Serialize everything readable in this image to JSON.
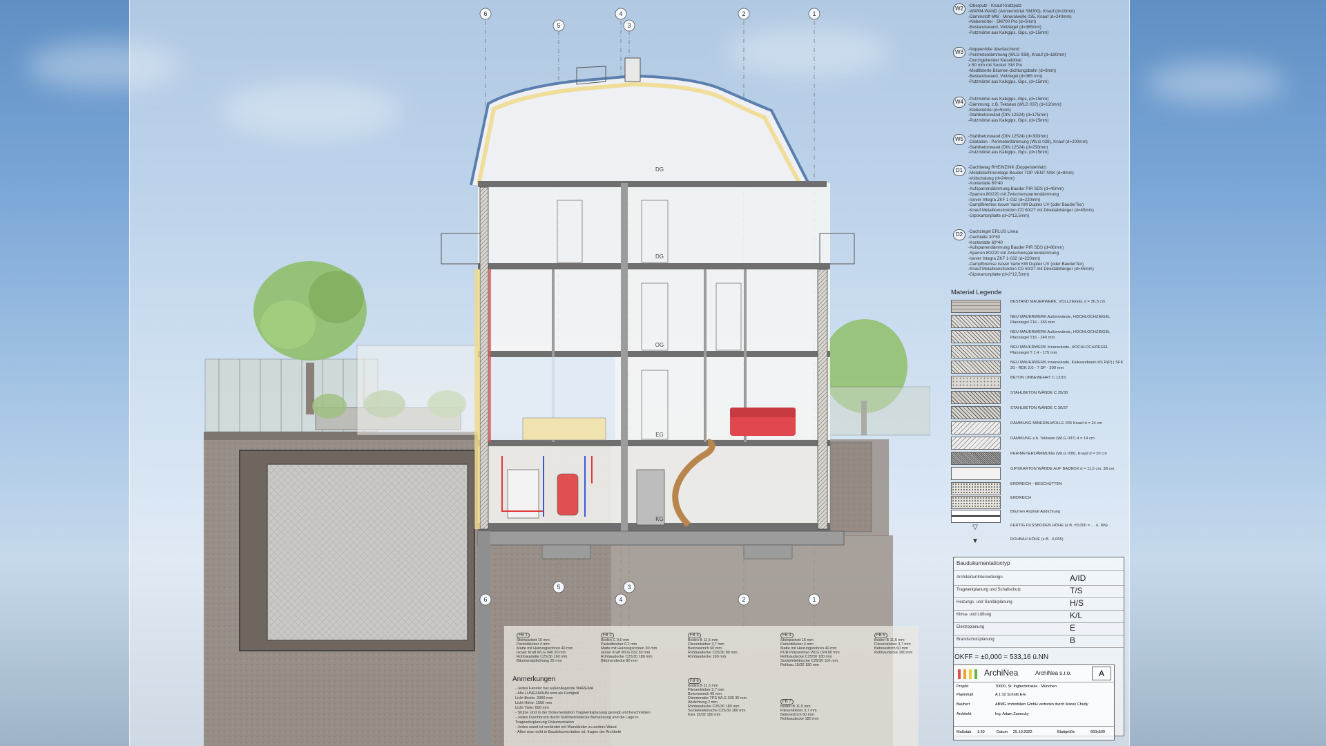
{
  "colors": {
    "sky_top": "#5f8fc4",
    "sheet": "#f4f7fc",
    "ground": "#8c7f75",
    "tree_green": "#8fbf6a",
    "sofa_red": "#e0474f",
    "insulation_yellow": "#f0d98a",
    "roof_blue": "#5a7fae"
  },
  "axes": {
    "top": [
      "6",
      "5",
      "4",
      "3",
      "2",
      "1"
    ],
    "bottom": [
      "6",
      "5",
      "4",
      "3",
      "2",
      "1"
    ]
  },
  "room_labels": {
    "attic": "DG",
    "floor3": "DG",
    "floor2": "OG",
    "floor1": "EG",
    "basement": "KG"
  },
  "wall_types": [
    {
      "code": "W2",
      "lines": [
        "-Oberputz - Knauf Kratzputz",
        "-WARM-WAND (Armiermörtel SM300), Knauf (d=10mm)",
        "-Dämmstoff MW - Mineralwolle 035, Knauf (d=240mm)",
        "-Klebemörtel - SM700 Pro (d=5mm)",
        "-Bestandswand, Vollziegel (d=365mm)",
        "-Putzmörtel aus Kalkgips, Gips, (d=15mm)"
      ]
    },
    {
      "code": "W3",
      "lines": [
        "-Noppenfolie überlaschend",
        "-Perimeterdämmung (WLG 038), Knauf (d=160mm)",
        "-Durchgehender Kieselübtal",
        "  ≥ 50 mm mit Sockel: SM Pro",
        "-Modifizierte Bitumen-dichtungsbahn (d=8mm)",
        "-Bestandswand, Vollziegel (d=365 mm)",
        "-Putzmörtel aus Kalkgips, Gips, (d=15mm)"
      ]
    },
    {
      "code": "W4",
      "lines": [
        "-Putzmörtel aus Kalkgips, Gips, (d=15mm)",
        "-Dämmung, z.B. Tektalan (WLG 037) (d=120mm)",
        "-Klebemörtel (d=5mm)",
        "-Stahlbetonwänd (DIN 12524) (d=175mm)",
        "-Putzmörtel aus Kalkgips, Gips, (d=15mm)"
      ]
    },
    {
      "code": "W5",
      "lines": [
        "-Stahlbetonwand (DIN 12524) (d=300mm)",
        "-Dilatation - Perimeterdämmung (WLG 038), Knauf (d=200mm)",
        "-Stahlbetonwand (DIN 12524) (d=250mm)",
        "-Putzmörtel aus Kalkgips, Gips, (d=15mm)"
      ]
    },
    {
      "code": "D1",
      "lines": [
        "-Dachbelag RHEINZINK (Doppelstehfalz)",
        "-Metalldachtrennlage Bauder TOP VENT NSK (d=8mm)",
        "-Vollschalung (d=24mm)",
        "-Konterlatte 60*40",
        "-Aufsparrendämmung Bauder PIR SDS (d=40mm)",
        "-Sparren 80/220 mit Zwischensparrendämmung",
        "-Isover Integra ZKF 1-032 (d=220mm)",
        "-Dampfbremse Isover Vario KM Duplex UV (oder BauderTex)",
        "-Knauf Metallkonstruktion CD 60/27 mit Direktabhänger (d=45mm)",
        "-Gipskartonplatte (d=2*12,5mm)"
      ]
    },
    {
      "code": "D2",
      "lines": [
        "-Dachziegel ERLUS Linea",
        "-Dachlatte 30*50",
        "-Konterlatte 60*40",
        "-Aufsparrendämmung Bauder PIR SDS (d=80mm)",
        "-Sparren 80/220 mit Zwischensparrendämmung",
        "-Isover Integra ZKF 1-032 (d=220mm)",
        "-Dampfbremse Isover Vario KM Duplex UV (oder BauderTex)",
        "-Knauf Metallkonstruktion CD 60/27 mit Direktabhänger (d=45mm)",
        "-Gipskartonplatte (d=2*12,5mm)"
      ]
    }
  ],
  "material_legend": {
    "title": "Material Legende",
    "items": [
      {
        "label": "BESTAND MAUERWERK, VOLLZIEGEL d = 36,5 cm",
        "pattern": "brick"
      },
      {
        "label": "NEU MAUERWERK Außenwände, HOCHLOCHZIEGEL Planziegel T16 - 365 mm",
        "pattern": "hatch"
      },
      {
        "label": "NEU MAUERWERK Außenwände, HOCHLOCHZIEGEL Planziegel T16 - 240 mm",
        "pattern": "hatch"
      },
      {
        "label": "NEU MAUERWERK Innenwände, HOCHLOCHZIEGEL Planziegel T 1,4 - 175 mm",
        "pattern": "hatch"
      },
      {
        "label": "NEU MAUERWERK Innenwände, Kalksandstein KS R(P) | SFK 20 - RDK 2,0 - 7 DF - 200 mm",
        "pattern": "hatch"
      },
      {
        "label": "BETON UNBEWEHRT C 12/15",
        "pattern": "dots"
      },
      {
        "label": "STAHLBETON WÄNDE C 25/30",
        "pattern": "cross"
      },
      {
        "label": "STAHLBETON WÄNDE C 30/37",
        "pattern": "cross"
      },
      {
        "label": "DÄMMUNG MINERALWOLLE 035 Knauf d = 24 cm",
        "pattern": "wave"
      },
      {
        "label": "DÄMMUNG z.b. Tektalan (WLG 037) d = 14 cm",
        "pattern": "wave"
      },
      {
        "label": "PERIMETERDÄMMUNG (WLG 038), Knauf d = 20 cm",
        "pattern": "dense"
      },
      {
        "label": "GIPSKARTON WÄNDE AUF BADBOX d = 11,5 cm, 38 cm",
        "pattern": "plain"
      },
      {
        "label": "ERDREICH - BESCHÜTTEN",
        "pattern": "soil"
      },
      {
        "label": "ERDREICH",
        "pattern": "soil"
      },
      {
        "label": "Bitumen Asphalt Abdichtung",
        "pattern": "line"
      },
      {
        "label": "FERTIG FUSSBODEN HÖHE (z.B. ±0,000 = … ü. NN)",
        "pattern": "triangle-open"
      },
      {
        "label": "ROHBAU HÖHE (z.B. -0,055)",
        "pattern": "triangle-filled"
      }
    ]
  },
  "doc_table": {
    "header": "Baudukumentationtyp",
    "rows": [
      {
        "label": "Architektur/Interiordesign",
        "code": "A/ID"
      },
      {
        "label": "Tragwerkplanung und Schallschutz",
        "code": "T/S"
      },
      {
        "label": "Heizungs- und Sanitärplanung",
        "code": "H/S"
      },
      {
        "label": "Klima- und Lüftung",
        "code": "K/L"
      },
      {
        "label": "Elektroplanung",
        "code": "E"
      },
      {
        "label": "Brandschutzplanung",
        "code": "B"
      }
    ]
  },
  "okff": "OKFF = ±0,000 = 533,16 ü.NN",
  "title_block": {
    "logo": "ArchiNea",
    "company": "ArchiNea s.r.o.",
    "sheet_letter": "A",
    "projekt_label": "Projekt",
    "projekt_value": "70000, St. Ingbertstrasse - München",
    "planinhalt_label": "Planinhalt",
    "planinhalt_value": "A 1:10 Schnitt E-E",
    "bauherr_label": "Bauherr",
    "bauherr_value": "ABMG Immobilien GmbH vertreten durch Marek Chudy",
    "architekt_label": "Architekt",
    "architekt_value": "Ing. Adam Zamecky",
    "massstab_label": "Maßstab",
    "massstab_value": "1:50",
    "datum_label": "Datum",
    "datum_value": "25.10.2022",
    "blatt_label": "Blattgröße",
    "blatt_value": "660x509"
  },
  "floor_build_ups": [
    {
      "code": "FB 1",
      "lines": [
        "Steinparkett 16 mm",
        "Parkettkleber 4 mm",
        "Matte mit Heizungsrohren 40 mm",
        "Isover Kraft WLG 040 20 mm",
        "Rohbauplatte C25/30 160 mm",
        "Bitumenabdichtung 35 mm"
      ]
    },
    {
      "code": "FB 2",
      "lines": [
        "Boden C 9,6 mm",
        "Parkettkleber 0,2 mm",
        "Matte mit Heizungsrohren 30 mm",
        "Isover Kraft WLG 032 30 mm",
        "Rohbaudecke C25/30 180 mm",
        "Bitumendecke 80 mm"
      ]
    },
    {
      "code": "FB 3",
      "lines": [
        "Boden B 11,5 mm",
        "Fliesenkleber 3,7 mm",
        "Betonestrich 60 mm",
        "Rohbaudecke C25/30 80 mm",
        "Rohbaudecke 180 mm"
      ]
    },
    {
      "code": "FB 4",
      "lines": [
        "Steinparkett 16 mm",
        "Parkettkleber 4 mm",
        "Matte mit Heizungsrohren 40 mm",
        "PUR Polyurethan WLG 024 80 mm",
        "Rohbaudecke C25/30 180 mm",
        "Sockelelektrische C25/30 110 mm",
        "Rohbau 15/32 180 mm"
      ]
    },
    {
      "code": "FB 5",
      "lines": [
        "Boden B 11,5 mm",
        "Fliesenkleber 3,7 mm",
        "Betonestrich 60 mm",
        "Rohbaudecke 180 mm"
      ]
    },
    {
      "code": "FB 6",
      "lines": [
        "Boden B 11,5 mm",
        "Fliesenkleber 3,7 mm",
        "Betonestrich 40 mm",
        "Dämmmatte TPS WLG 035 30 mm",
        "Abdichtung 2 mm",
        "Rohbaudecke C25/30 180 mm",
        "Sockelelektrische C25/30 180 mm",
        "Kies 15/32 180 mm"
      ]
    },
    {
      "code": "FB 7",
      "lines": [
        "Boden B 11,5 mm",
        "Fliesenkleber 3,7 mm",
        "Betonestrich 60 mm",
        "Rohbaudecke 180 mm"
      ]
    }
  ],
  "anmerkungen": {
    "title": "Anmerkungen",
    "lines": [
      "- Jedes Fenster hat außenliegende WAREMA",
      "- Alle LUNEZANUM sind als Fertigteil",
      "  Licht Breite: 2050 mm",
      "  Licht Höhe: 1550 mm",
      "  Licht Tiefe: 690 mm",
      "- Stütze sind in der Dokumentation Tragwerksplanung gezeigt und beschrieben",
      "- Jedes Durchbruch durch Stahlbetondecke Bemessung und die Lage in",
      "  Tragwerksplanung Dokumentation",
      "- Jedes wand ist verbindet mit Wandänder zu andere Wand",
      "- Alles was nicht in Baudokumentation ist, fragen der Architekt"
    ]
  }
}
